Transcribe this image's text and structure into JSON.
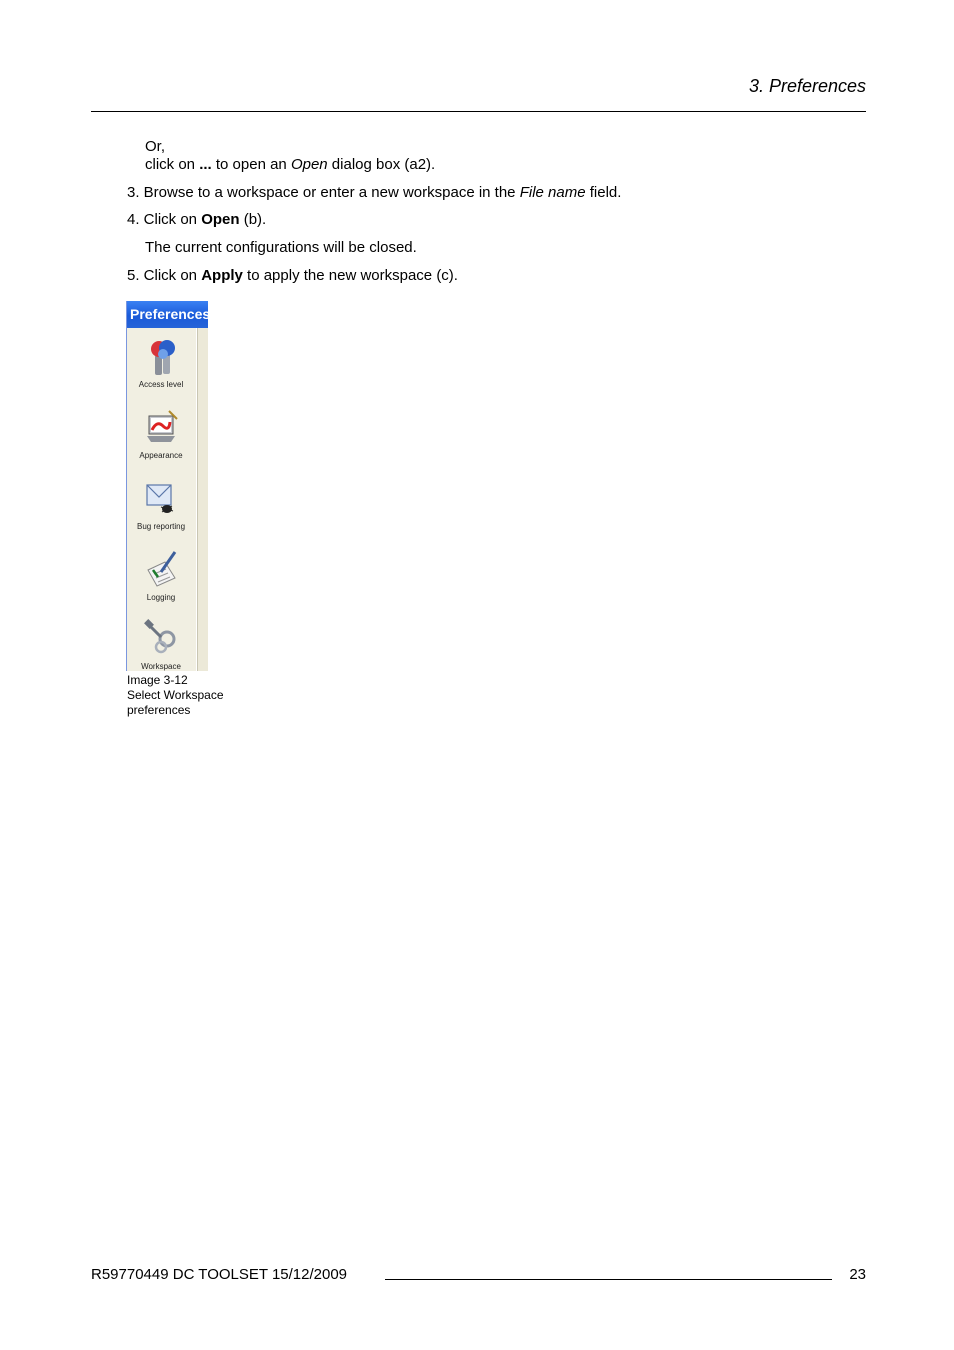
{
  "header": {
    "title": "3.  Preferences"
  },
  "steps": {
    "or_line": "Or,",
    "click_on_prefix": "click on ",
    "ellipsis_bold": "...",
    "click_on_middle": "  to open an ",
    "open_italic": "Open",
    "click_on_suffix": " dialog box (a2).",
    "step3_prefix": "3. Browse to a workspace or enter a new workspace in the ",
    "step3_italic": "File name",
    "step3_suffix": " field.",
    "step4_prefix": "4. Click on ",
    "step4_bold": "Open",
    "step4_suffix": " (b).",
    "step4_note": "The current configurations will be closed.",
    "step5_prefix": "5. Click on ",
    "step5_bold": "Apply",
    "step5_suffix": " to apply the new workspace (c)."
  },
  "screenshot": {
    "window_title": "Preferences",
    "items": [
      {
        "label": "Access level",
        "icon": "keys-icon"
      },
      {
        "label": "Appearance",
        "icon": "appearance-icon"
      },
      {
        "label": "Bug reporting",
        "icon": "bug-envelope-icon"
      },
      {
        "label": "Logging",
        "icon": "logging-pen-icon"
      },
      {
        "label": "Workspace",
        "icon": "workspace-tools-icon"
      }
    ]
  },
  "caption": {
    "line1": "Image 3-12",
    "line2": "Select Workspace",
    "line3": "preferences"
  },
  "footer": {
    "doc_info": "R59770449   DC TOOLSET  15/12/2009",
    "page_number": "23"
  },
  "colors": {
    "titlebar": "#1a5ad9",
    "panel_bg": "#ece9d8"
  }
}
